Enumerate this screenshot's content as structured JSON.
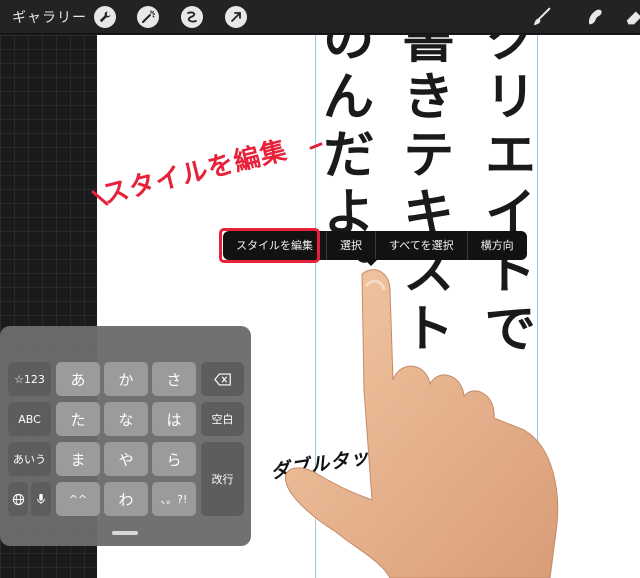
{
  "toolbar": {
    "gallery_label": "ギャラリー"
  },
  "canvas": {
    "columns": [
      "クリエイトで",
      "書きテキスト「",
      "のんだよ。"
    ]
  },
  "context_menu": {
    "items": [
      "スタイルを編集",
      "選択",
      "すべてを選択",
      "横方向"
    ]
  },
  "annotations": {
    "style_label": "スタイルを編集",
    "double_tap_label": "ダブルタップ"
  },
  "keyboard": {
    "keys": {
      "symbols": "☆123",
      "abc": "ABC",
      "kana": "あいう",
      "a": "あ",
      "ka": "か",
      "sa": "さ",
      "ta": "た",
      "na": "な",
      "ha": "は",
      "ma": "ま",
      "ya": "や",
      "ra": "ら",
      "small": "^^",
      "wa": "わ",
      "punct": "、。?!",
      "space": "空白",
      "enter": "改行"
    }
  },
  "colors": {
    "accent": "#e8213a",
    "toolbar_bg": "#232325",
    "guide": "#9cc8e6"
  }
}
